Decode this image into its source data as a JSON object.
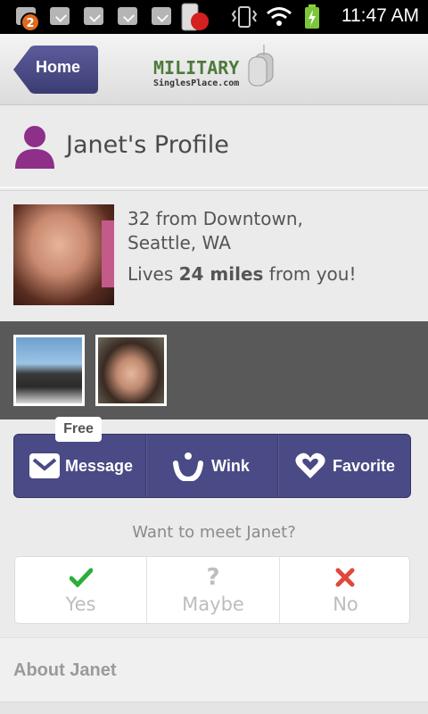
{
  "status_bar": {
    "notification_count": "2",
    "time": "11:47 AM",
    "icons": [
      "notification-icon",
      "clipboard-icon",
      "clipboard-icon",
      "clipboard-icon",
      "clipboard-icon",
      "phone-record-icon",
      "vibrate-icon",
      "wifi-icon",
      "battery-charging-icon"
    ]
  },
  "header": {
    "home_label": "Home",
    "logo_main": "MILITARY",
    "logo_sub": "SinglesPlace.com"
  },
  "profile": {
    "title": "Janet's Profile",
    "age_location_line1": "32 from Downtown,",
    "age_location_line2": "Seattle, WA",
    "distance_prefix": "Lives ",
    "distance_value": "24 miles",
    "distance_suffix": " from you!"
  },
  "actions": {
    "free_badge": "Free",
    "message_label": "Message",
    "wink_label": "Wink",
    "favorite_label": "Favorite"
  },
  "meet": {
    "question": "Want to meet Janet?",
    "yes_label": "Yes",
    "maybe_label": "Maybe",
    "no_label": "No"
  },
  "about": {
    "title": "About Janet"
  },
  "colors": {
    "accent_purple": "#4a4a86",
    "person_icon": "#8e2f8a",
    "yes_green": "#2cad3a",
    "no_red": "#e0483c",
    "logo_green": "#4d7a3a"
  }
}
